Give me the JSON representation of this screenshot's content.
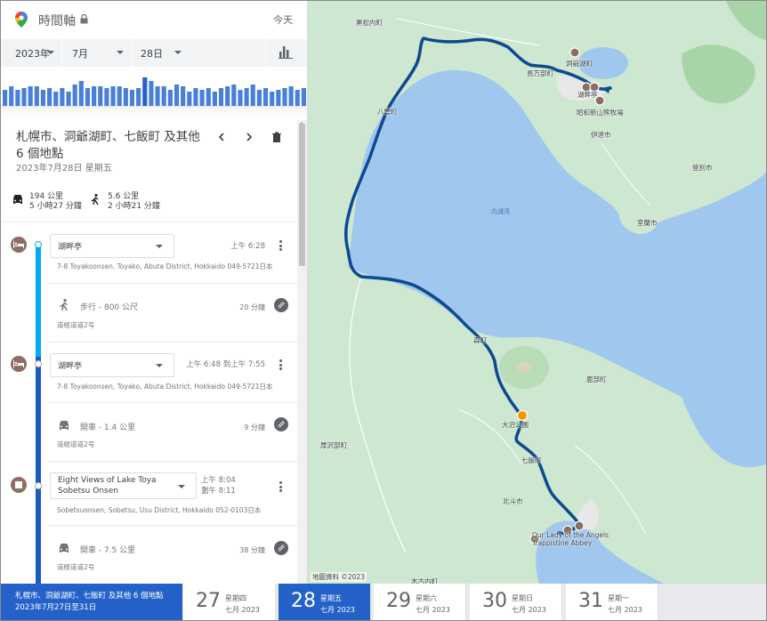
{
  "app": {
    "title": "時間軸",
    "today_label": "今天"
  },
  "date_selectors": {
    "year": "2023年",
    "month": "7月",
    "day": "28日"
  },
  "histogram": [
    0.45,
    0.55,
    0.45,
    0.5,
    0.55,
    0.55,
    0.45,
    0.5,
    0.4,
    0.5,
    0.4,
    0.6,
    0.7,
    0.5,
    0.55,
    0.55,
    0.5,
    0.55,
    0.55,
    0.5,
    0.45,
    0.5,
    0.8,
    0.7,
    0.55,
    0.55,
    0.45,
    0.6,
    0.55,
    0.4,
    0.5,
    0.45,
    0.5,
    0.4,
    0.5,
    0.55,
    0.6,
    0.45,
    0.5,
    0.6,
    0.45,
    0.5,
    0.4,
    0.45,
    0.5,
    0.55,
    0.45,
    0.5
  ],
  "summary": {
    "title": "札幌市、洞爺湖町、七飯町 及其他 6 個地點",
    "date": "2023年7月28日 星期五",
    "drive_distance": "194 公里",
    "drive_duration": "5 小時27 分鐘",
    "walk_distance": "5.6 公里",
    "walk_duration": "2 小時21 分鐘"
  },
  "timeline": [
    {
      "kind": "place",
      "name": "湖畔亭",
      "time": "上午 6:28",
      "address": "7-8 Toyakoonsen, Toyako, Abuta District, Hokkaido 049-5721日本"
    },
    {
      "kind": "move",
      "label": "步行 - 800 公尺",
      "duration": "20 分鐘",
      "sub": "道經道道2号"
    },
    {
      "kind": "place",
      "name": "湖畔亭",
      "time": "上午 6:48 到上午 7:55",
      "address": "7-8 Toyakoonsen, Toyako, Abuta District, Hokkaido 049-5721日本"
    },
    {
      "kind": "move",
      "label": "開車 - 1.4 公里",
      "duration": "9 分鐘",
      "sub": "道經道道2号"
    },
    {
      "kind": "place",
      "name": "Eight Views of Lake Toya Sobetsu Onsen",
      "time_line1": "上午 8:04 到",
      "time_line2": "上午 8:11",
      "address": "Sobetsuonsen, Sobetsu, Usu District, Hokkaido 052-0103日本"
    },
    {
      "kind": "move",
      "label": "開車 - 7.5 公里",
      "duration": "38 分鐘",
      "sub": "道經道道2号"
    }
  ],
  "map": {
    "labels": {
      "kuromatsunai": "黒松内町",
      "oshamambe": "長万部町",
      "toyako": "洞爺湖町",
      "kohantei": "湖畔亭",
      "showashinzan": "昭和新山熊牧場",
      "date": "伊達市",
      "noboribetsu": "登別市",
      "muroran": "室蘭市",
      "uchiurawan": "内浦湾",
      "yakumo": "八雲町",
      "mori": "森町",
      "shikabe": "鹿部町",
      "atsusawabe": "厚沢部町",
      "onuma": "大沼公園",
      "nanae": "七飯町",
      "hokuto": "北斗市",
      "trappistine": "Our Lady of the Angels Trappistine Abbey",
      "kikonai": "木古内町",
      "copyright": "地圖資料 ©2023"
    }
  },
  "day_strip": {
    "range_title": "札幌市、洞爺湖町、七飯町 及其他 6 個地點",
    "range_dates": "2023年7月27日至31日",
    "days": [
      {
        "num": "27",
        "weekday": "星期四",
        "month": "七月 2023",
        "active": false
      },
      {
        "num": "28",
        "weekday": "星期五",
        "month": "七月 2023",
        "active": true
      },
      {
        "num": "29",
        "weekday": "星期六",
        "month": "七月 2023",
        "active": false
      },
      {
        "num": "30",
        "weekday": "星期日",
        "month": "七月 2023",
        "active": false
      },
      {
        "num": "31",
        "weekday": "星期一",
        "month": "七月 2023",
        "active": false
      }
    ]
  },
  "colors": {
    "accent": "#2462c9",
    "route": "#0d4a8f",
    "timeline_light": "#03a9f4",
    "place_icon": "#8d6e63"
  }
}
